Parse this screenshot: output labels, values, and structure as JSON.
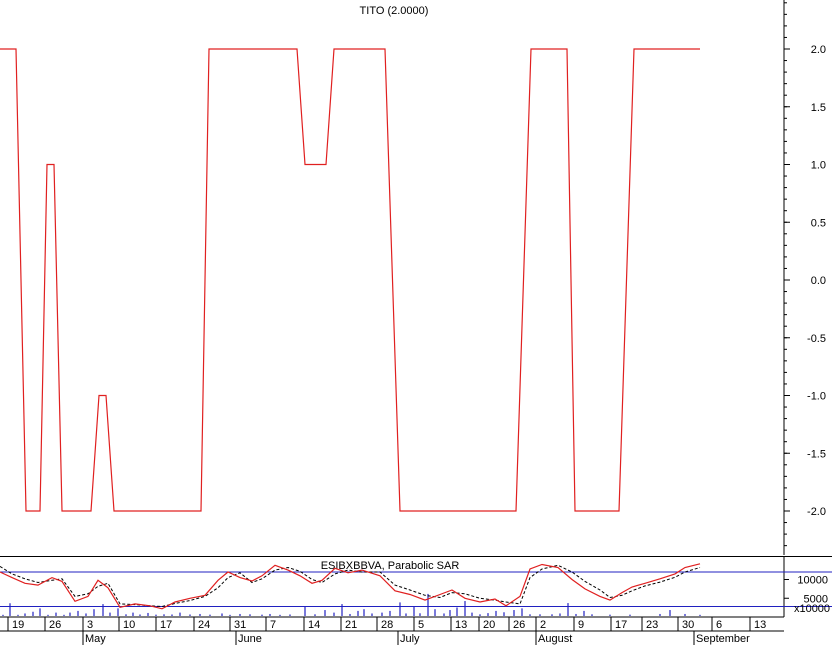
{
  "chart_data": [
    {
      "type": "line",
      "title": "TITO (2.0000)",
      "ylim": [
        -2.5,
        2.5
      ],
      "yticks": [
        "2.0",
        "1.5",
        "1.0",
        "0.5",
        "0.0",
        "-0.5",
        "-1.0",
        "-1.5",
        "-2.0"
      ],
      "yticks_values": [
        2.0,
        1.5,
        1.0,
        0.5,
        0.0,
        -0.5,
        -1.0,
        -1.5,
        -2.0
      ],
      "color": "#e02020",
      "series": [
        {
          "values": [
            [
              0,
              2
            ],
            [
              16,
              2
            ],
            [
              26,
              -2
            ],
            [
              40,
              -2
            ],
            [
              47,
              1
            ],
            [
              54,
              1
            ],
            [
              62,
              -2
            ],
            [
              91,
              -2
            ],
            [
              99,
              -1
            ],
            [
              106,
              -1
            ],
            [
              114,
              -2
            ],
            [
              201,
              -2
            ],
            [
              209,
              2
            ],
            [
              297,
              2
            ],
            [
              305,
              1
            ],
            [
              326,
              1
            ],
            [
              334,
              2
            ],
            [
              385,
              2
            ],
            [
              400,
              -2
            ],
            [
              516,
              -2
            ],
            [
              531,
              2
            ],
            [
              567,
              2
            ],
            [
              575,
              -2
            ],
            [
              619,
              -2
            ],
            [
              634,
              2
            ],
            [
              700,
              2
            ]
          ]
        }
      ]
    },
    {
      "type": "line",
      "title": "ESIBXBBVA, Parabolic SAR",
      "ylim": [
        0,
        15000
      ],
      "yticks": [
        "10000",
        "5000"
      ],
      "yticks_values": [
        10000,
        5000
      ],
      "unit_label": "x10000",
      "reference_line": 12000,
      "colors": {
        "price": "#e02020",
        "sar": "#000000",
        "volume": "#2020c0",
        "reference": "#2020c0"
      },
      "series": [
        {
          "values": [
            [
              0,
              12000
            ],
            [
              12,
              10500
            ],
            [
              25,
              9000
            ],
            [
              38,
              8500
            ],
            [
              52,
              10500
            ],
            [
              62,
              9500
            ],
            [
              75,
              4200
            ],
            [
              88,
              5500
            ],
            [
              98,
              9800
            ],
            [
              108,
              7800
            ],
            [
              120,
              2600
            ],
            [
              135,
              3500
            ],
            [
              150,
              3000
            ],
            [
              162,
              2200
            ],
            [
              175,
              4000
            ],
            [
              190,
              5000
            ],
            [
              205,
              5800
            ],
            [
              218,
              9800
            ],
            [
              228,
              12000
            ],
            [
              240,
              10500
            ],
            [
              252,
              9600
            ],
            [
              262,
              11000
            ],
            [
              275,
              13800
            ],
            [
              288,
              12500
            ],
            [
              300,
              11000
            ],
            [
              312,
              9000
            ],
            [
              322,
              9800
            ],
            [
              335,
              13000
            ],
            [
              348,
              11800
            ],
            [
              362,
              12500
            ],
            [
              380,
              11000
            ],
            [
              395,
              7000
            ],
            [
              410,
              6000
            ],
            [
              425,
              4500
            ],
            [
              440,
              6000
            ],
            [
              452,
              7200
            ],
            [
              465,
              5000
            ],
            [
              480,
              4000
            ],
            [
              495,
              4800
            ],
            [
              506,
              3000
            ],
            [
              520,
              5500
            ],
            [
              530,
              12800
            ],
            [
              542,
              14000
            ],
            [
              558,
              13200
            ],
            [
              572,
              10000
            ],
            [
              585,
              7500
            ],
            [
              600,
              5500
            ],
            [
              610,
              4500
            ],
            [
              622,
              6500
            ],
            [
              632,
              8000
            ],
            [
              645,
              9000
            ],
            [
              660,
              10200
            ],
            [
              675,
              11500
            ],
            [
              685,
              13200
            ],
            [
              700,
              14200
            ]
          ]
        },
        {
          "values": [
            [
              0,
              13500
            ],
            [
              12,
              11500
            ],
            [
              25,
              10200
            ],
            [
              38,
              9200
            ],
            [
              52,
              9800
            ],
            [
              62,
              10200
            ],
            [
              75,
              5500
            ],
            [
              88,
              6200
            ],
            [
              98,
              8200
            ],
            [
              108,
              9000
            ],
            [
              120,
              3500
            ],
            [
              135,
              3300
            ],
            [
              150,
              3000
            ],
            [
              162,
              2800
            ],
            [
              175,
              3600
            ],
            [
              190,
              4400
            ],
            [
              205,
              5500
            ],
            [
              218,
              7800
            ],
            [
              228,
              10500
            ],
            [
              240,
              11800
            ],
            [
              252,
              9200
            ],
            [
              262,
              10200
            ],
            [
              275,
              12500
            ],
            [
              288,
              13200
            ],
            [
              300,
              12200
            ],
            [
              312,
              10000
            ],
            [
              322,
              9200
            ],
            [
              335,
              11500
            ],
            [
              348,
              12500
            ],
            [
              362,
              12000
            ],
            [
              380,
              12000
            ],
            [
              395,
              8500
            ],
            [
              410,
              7200
            ],
            [
              425,
              5800
            ],
            [
              440,
              5200
            ],
            [
              452,
              6500
            ],
            [
              465,
              6200
            ],
            [
              480,
              5000
            ],
            [
              495,
              4500
            ],
            [
              506,
              4000
            ],
            [
              520,
              3500
            ],
            [
              530,
              10500
            ],
            [
              542,
              12800
            ],
            [
              558,
              13800
            ],
            [
              572,
              12000
            ],
            [
              585,
              9500
            ],
            [
              600,
              7200
            ],
            [
              610,
              5200
            ],
            [
              622,
              5800
            ],
            [
              632,
              7000
            ],
            [
              645,
              8300
            ],
            [
              660,
              9300
            ],
            [
              675,
              10600
            ],
            [
              685,
              12000
            ],
            [
              700,
              13200
            ]
          ]
        }
      ],
      "volume": [
        [
          3,
          700
        ],
        [
          10,
          7500
        ],
        [
          18,
          700
        ],
        [
          25,
          1500
        ],
        [
          33,
          2500
        ],
        [
          40,
          4500
        ],
        [
          48,
          700
        ],
        [
          56,
          2000
        ],
        [
          64,
          700
        ],
        [
          70,
          2000
        ],
        [
          78,
          3000
        ],
        [
          86,
          1500
        ],
        [
          94,
          4000
        ],
        [
          103,
          7000
        ],
        [
          110,
          2000
        ],
        [
          118,
          4500
        ],
        [
          126,
          1000
        ],
        [
          133,
          2000
        ],
        [
          140,
          900
        ],
        [
          148,
          1800
        ],
        [
          156,
          800
        ],
        [
          164,
          1000
        ],
        [
          172,
          900
        ],
        [
          180,
          2000
        ],
        [
          190,
          900
        ],
        [
          200,
          1200
        ],
        [
          210,
          800
        ],
        [
          222,
          1500
        ],
        [
          230,
          700
        ],
        [
          240,
          1200
        ],
        [
          250,
          1000
        ],
        [
          262,
          800
        ],
        [
          270,
          1200
        ],
        [
          280,
          700
        ],
        [
          290,
          900
        ],
        [
          305,
          5500
        ],
        [
          315,
          1000
        ],
        [
          325,
          3500
        ],
        [
          334,
          2000
        ],
        [
          342,
          7000
        ],
        [
          350,
          1200
        ],
        [
          358,
          3000
        ],
        [
          364,
          4000
        ],
        [
          372,
          1500
        ],
        [
          382,
          2000
        ],
        [
          390,
          3000
        ],
        [
          400,
          8000
        ],
        [
          406,
          1500
        ],
        [
          414,
          5500
        ],
        [
          420,
          1600
        ],
        [
          428,
          13000
        ],
        [
          435,
          4000
        ],
        [
          444,
          1500
        ],
        [
          450,
          3500
        ],
        [
          457,
          5000
        ],
        [
          465,
          8800
        ],
        [
          472,
          2000
        ],
        [
          480,
          1000
        ],
        [
          488,
          1700
        ],
        [
          496,
          3000
        ],
        [
          504,
          2200
        ],
        [
          514,
          3500
        ],
        [
          522,
          4500
        ],
        [
          530,
          1000
        ],
        [
          540,
          1000
        ],
        [
          552,
          1000
        ],
        [
          560,
          1500
        ],
        [
          568,
          7600
        ],
        [
          576,
          1200
        ],
        [
          584,
          3000
        ],
        [
          592,
          1000
        ],
        [
          610,
          800
        ],
        [
          630,
          800
        ],
        [
          660,
          1200
        ],
        [
          670,
          3500
        ],
        [
          685,
          1200
        ],
        [
          700,
          700
        ]
      ]
    }
  ],
  "x_axis": {
    "day_ticks": [
      "19",
      "26",
      "3",
      "10",
      "17",
      "24",
      "31",
      "7",
      "14",
      "21",
      "28",
      "5",
      "13",
      "20",
      "26",
      "2",
      "9",
      "17",
      "23",
      "30",
      "6",
      "13"
    ],
    "months": [
      "May",
      "June",
      "July",
      "August",
      "September"
    ]
  }
}
